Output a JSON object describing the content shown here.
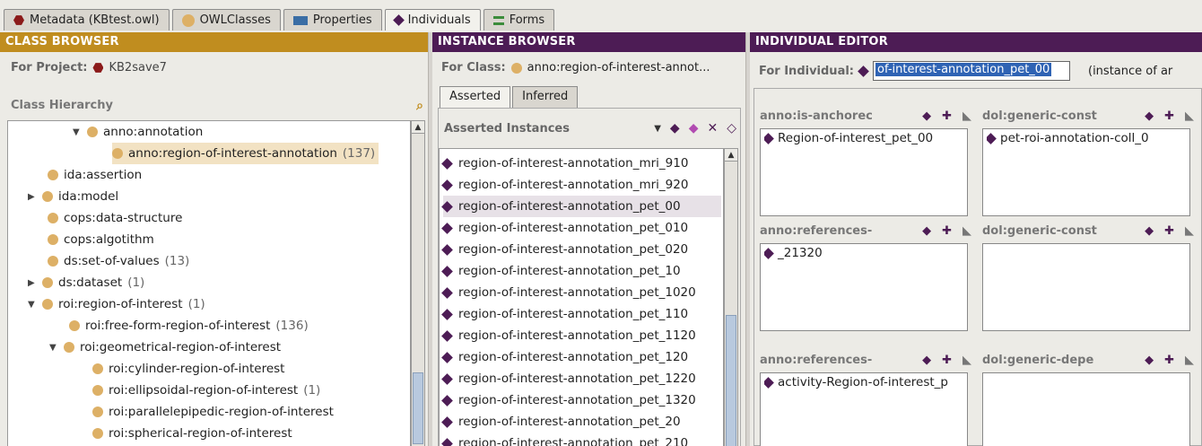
{
  "tabs": [
    {
      "label": "Metadata (KBtest.owl)",
      "icon": "red-hex-icon"
    },
    {
      "label": "OWLClasses",
      "icon": "gold-dot-icon"
    },
    {
      "label": "Properties",
      "icon": "blue-rect-icon"
    },
    {
      "label": "Individuals",
      "icon": "purple-diamond-icon",
      "active": true
    },
    {
      "label": "Forms",
      "icon": "forms-icon"
    }
  ],
  "class_browser": {
    "title": "CLASS BROWSER",
    "project_label": "For Project:",
    "project_name": "KB2save7",
    "hierarchy_label": "Class Hierarchy",
    "items": [
      {
        "label": "anno:annotation",
        "count": "",
        "toggle": "▼"
      },
      {
        "label": "anno:region-of-interest-annotation",
        "count": "(137)",
        "toggle": ""
      },
      {
        "label": "ida:assertion",
        "count": "",
        "toggle": ""
      },
      {
        "label": "ida:model",
        "count": "",
        "toggle": "▶"
      },
      {
        "label": "cops:data-structure",
        "count": "",
        "toggle": ""
      },
      {
        "label": "cops:algotithm",
        "count": "",
        "toggle": ""
      },
      {
        "label": "ds:set-of-values",
        "count": "(13)",
        "toggle": ""
      },
      {
        "label": "ds:dataset",
        "count": "(1)",
        "toggle": "▶"
      },
      {
        "label": "roi:region-of-interest",
        "count": "(1)",
        "toggle": "▼"
      },
      {
        "label": "roi:free-form-region-of-interest",
        "count": "(136)",
        "toggle": ""
      },
      {
        "label": "roi:geometrical-region-of-interest",
        "count": "",
        "toggle": "▼"
      },
      {
        "label": "roi:cylinder-region-of-interest",
        "count": "",
        "toggle": ""
      },
      {
        "label": "roi:ellipsoidal-region-of-interest",
        "count": "(1)",
        "toggle": ""
      },
      {
        "label": "roi:parallelepipedic-region-of-interest",
        "count": "",
        "toggle": ""
      },
      {
        "label": "roi:spherical-region-of-interest",
        "count": "",
        "toggle": ""
      }
    ]
  },
  "instance_browser": {
    "title": "INSTANCE BROWSER",
    "for_class_label": "For Class:",
    "for_class_value": "anno:region-of-interest-annot...",
    "subtabs": [
      "Asserted",
      "Inferred"
    ],
    "asserted_label": "Asserted Instances",
    "instances": [
      "region-of-interest-annotation_mri_910",
      "region-of-interest-annotation_mri_920",
      "region-of-interest-annotation_pet_00",
      "region-of-interest-annotation_pet_010",
      "region-of-interest-annotation_pet_020",
      "region-of-interest-annotation_pet_10",
      "region-of-interest-annotation_pet_1020",
      "region-of-interest-annotation_pet_110",
      "region-of-interest-annotation_pet_1120",
      "region-of-interest-annotation_pet_120",
      "region-of-interest-annotation_pet_1220",
      "region-of-interest-annotation_pet_1320",
      "region-of-interest-annotation_pet_20",
      "region-of-interest-annotation_pet_210"
    ]
  },
  "individual_editor": {
    "title": "INDIVIDUAL EDITOR",
    "for_individual_label": "For Individual:",
    "individual_value": "of-interest-annotation_pet_00",
    "instance_of_text": "(instance of ar",
    "slots": [
      {
        "title": "anno:is-anchorec",
        "value": "Region-of-interest_pet_00"
      },
      {
        "title": "dol:generic-const",
        "value": "pet-roi-annotation-coll_0"
      },
      {
        "title": "anno:references-",
        "value": "_21320"
      },
      {
        "title": "dol:generic-const",
        "value": ""
      },
      {
        "title": "anno:references-",
        "value": "activity-Region-of-interest_p"
      },
      {
        "title": "dol:generic-depe",
        "value": ""
      }
    ]
  }
}
